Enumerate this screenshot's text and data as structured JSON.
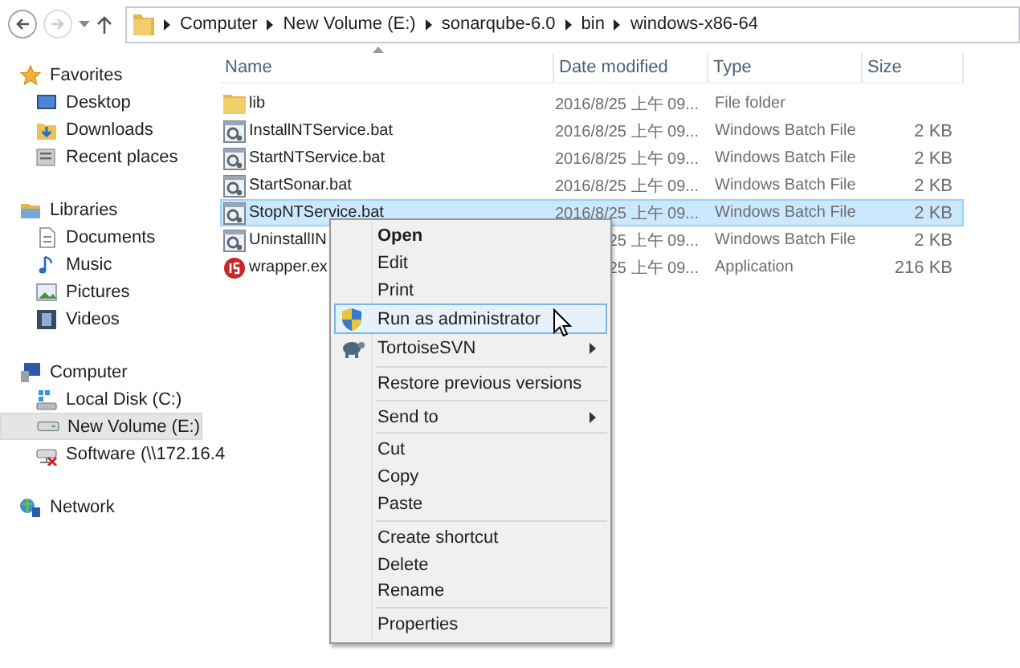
{
  "address_bar": {
    "crumbs": [
      "Computer",
      "New Volume (E:)",
      "sonarqube-6.0",
      "bin",
      "windows-x86-64"
    ]
  },
  "navigation": [
    {
      "label": "Favorites",
      "kind": "favorites",
      "children": [
        {
          "label": "Desktop",
          "kind": "desktop",
          "selected": false
        },
        {
          "label": "Downloads",
          "kind": "downloads",
          "selected": false
        },
        {
          "label": "Recent places",
          "kind": "recent",
          "selected": false
        }
      ]
    },
    {
      "label": "Libraries",
      "kind": "libraries",
      "children": [
        {
          "label": "Documents",
          "kind": "documents",
          "selected": false
        },
        {
          "label": "Music",
          "kind": "music",
          "selected": false
        },
        {
          "label": "Pictures",
          "kind": "pictures",
          "selected": false
        },
        {
          "label": "Videos",
          "kind": "videos",
          "selected": false
        }
      ]
    },
    {
      "label": "Computer",
      "kind": "computer",
      "children": [
        {
          "label": "Local Disk (C:)",
          "kind": "disk",
          "selected": false
        },
        {
          "label": "New Volume (E:)",
          "kind": "drive",
          "selected": true
        },
        {
          "label": "Software (\\\\172.16.4",
          "kind": "netdrive",
          "selected": false
        }
      ]
    },
    {
      "label": "Network",
      "kind": "network"
    }
  ],
  "file_list": {
    "columns": [
      "Name",
      "Date modified",
      "Type",
      "Size"
    ],
    "rows": [
      {
        "kind": "folder",
        "name": "lib",
        "date": "2016/8/25 上午 09...",
        "type": "File folder",
        "selected": false
      },
      {
        "kind": "batch",
        "name": "InstallNTService.bat",
        "date": "2016/8/25 上午 09...",
        "type": "Windows Batch File",
        "size": "2 KB",
        "selected": false
      },
      {
        "kind": "batch",
        "name": "StartNTService.bat",
        "date": "2016/8/25 上午 09...",
        "type": "Windows Batch File",
        "size": "2 KB",
        "selected": false
      },
      {
        "kind": "batch",
        "name": "StartSonar.bat",
        "date": "2016/8/25 上午 09...",
        "type": "Windows Batch File",
        "size": "2 KB",
        "selected": false
      },
      {
        "kind": "batch",
        "name": "StopNTService.bat",
        "date": "2016/8/25 上午 09...",
        "type": "Windows Batch File",
        "size": "2 KB",
        "selected": true
      },
      {
        "kind": "batch",
        "name": "UninstallIN",
        "date": "25 上午 09...",
        "type": "Windows Batch File",
        "size": "2 KB",
        "selected": false
      },
      {
        "kind": "app",
        "name": "wrapper.ex",
        "date": "25 上午 09...",
        "type": "Application",
        "size": "216 KB",
        "selected": false
      }
    ]
  },
  "context_menu": [
    {
      "kind": "item",
      "label": "Open",
      "default": true,
      "submenu": false,
      "selected": false
    },
    {
      "kind": "item",
      "label": "Edit",
      "default": false,
      "submenu": false,
      "selected": false
    },
    {
      "kind": "item",
      "label": "Print",
      "default": false,
      "submenu": false,
      "selected": false
    },
    {
      "kind": "shield",
      "label": "Run as administrator",
      "default": false,
      "submenu": false,
      "selected": true
    },
    {
      "kind": "turtle",
      "label": "TortoiseSVN",
      "default": false,
      "submenu": true,
      "selected": false
    },
    {
      "kind": "separator"
    },
    {
      "kind": "item",
      "label": "Restore previous versions",
      "default": false,
      "submenu": false,
      "selected": false
    },
    {
      "kind": "separator"
    },
    {
      "kind": "item",
      "label": "Send to",
      "default": false,
      "submenu": true,
      "selected": false
    },
    {
      "kind": "separator"
    },
    {
      "kind": "item",
      "label": "Cut",
      "default": false,
      "submenu": false,
      "selected": false
    },
    {
      "kind": "item",
      "label": "Copy",
      "default": false,
      "submenu": false,
      "selected": false
    },
    {
      "kind": "item",
      "label": "Paste",
      "default": false,
      "submenu": false,
      "selected": false
    },
    {
      "kind": "separator"
    },
    {
      "kind": "item",
      "label": "Create shortcut",
      "default": false,
      "submenu": false,
      "selected": false
    },
    {
      "kind": "item",
      "label": "Delete",
      "default": false,
      "submenu": false,
      "selected": false
    },
    {
      "kind": "item",
      "label": "Rename",
      "default": false,
      "submenu": false,
      "selected": false
    },
    {
      "kind": "separator"
    },
    {
      "kind": "item",
      "label": "Properties",
      "default": false,
      "submenu": false,
      "selected": false
    }
  ]
}
